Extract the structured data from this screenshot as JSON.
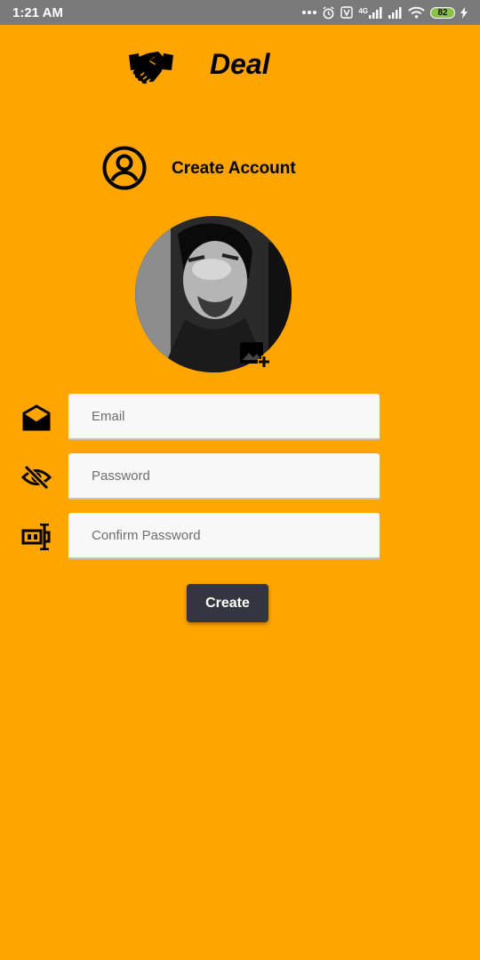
{
  "status_bar": {
    "time": "1:21 AM",
    "network_label": "4G",
    "battery": "82",
    "icons": [
      "more-icon",
      "alarm-icon",
      "volte-icon",
      "signal-icon",
      "signal-icon",
      "wifi-icon",
      "battery-icon",
      "charging-icon"
    ]
  },
  "app": {
    "title": "Deal",
    "logo_icon": "handshake-icon"
  },
  "section": {
    "title": "Create Account",
    "icon": "account-circle-icon"
  },
  "avatar": {
    "edit_icon": "add-photo-icon"
  },
  "form": {
    "email": {
      "placeholder": "Email",
      "value": "",
      "icon": "email-icon"
    },
    "password": {
      "placeholder": "Password",
      "value": "",
      "icon": "visibility-off-icon"
    },
    "confirm_password": {
      "placeholder": "Confirm Password",
      "value": "",
      "icon": "password-text-icon"
    },
    "submit_label": "Create"
  },
  "colors": {
    "background": "#FFA500",
    "status_bar": "#7a7a7a",
    "input_bg": "#f8f8f8",
    "button_bg": "#333640",
    "button_text": "#ffffff",
    "battery": "#8bc34a"
  }
}
